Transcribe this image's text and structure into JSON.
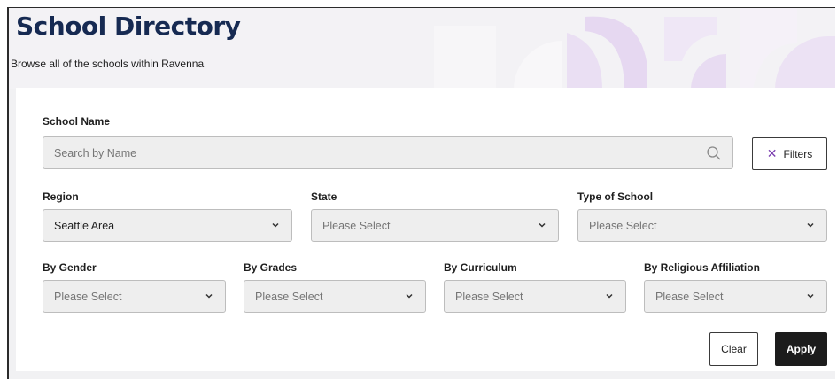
{
  "header": {
    "title": "School Directory",
    "subtitle": "Browse all of the schools within Ravenna"
  },
  "search": {
    "label": "School Name",
    "placeholder": "Search by Name",
    "filters_label": "Filters"
  },
  "filters_row1": [
    {
      "label": "Region",
      "value": "Seattle Area"
    },
    {
      "label": "State",
      "value": "Please Select"
    },
    {
      "label": "Type of School",
      "value": "Please Select"
    }
  ],
  "filters_row2": [
    {
      "label": "By Gender",
      "value": "Please Select"
    },
    {
      "label": "By Grades",
      "value": "Please Select"
    },
    {
      "label": "By Curriculum",
      "value": "Please Select"
    },
    {
      "label": "By Religious Affiliation",
      "value": "Please Select"
    }
  ],
  "actions": {
    "clear_label": "Clear",
    "apply_label": "Apply"
  },
  "colors": {
    "title": "#162a52",
    "apply_bg": "#1c1c1c",
    "filters_x": "#7b3fb0",
    "deco_purple": "#e6d8f1"
  }
}
